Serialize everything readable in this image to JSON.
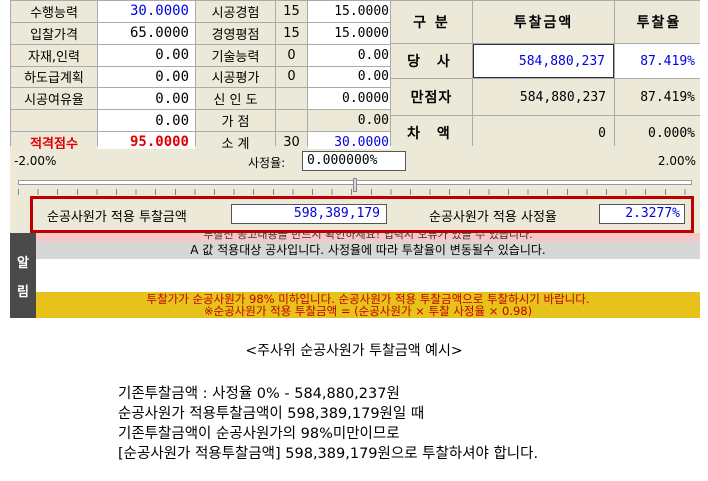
{
  "score": {
    "rows": [
      {
        "label": "수행능력",
        "value": "30.0000",
        "label2": "시공경험",
        "num": "15",
        "value2": "15.0000"
      },
      {
        "label": "입찰가격",
        "value": "65.0000",
        "label2": "경영평점",
        "num": "15",
        "value2": "15.0000"
      },
      {
        "label": "자재,인력",
        "value": "0.00",
        "label2": "기술능력",
        "num": "0",
        "value2": "0.00"
      },
      {
        "label": "하도급계획",
        "value": "0.00",
        "label2": "시공평가",
        "num": "0",
        "value2": "0.00"
      },
      {
        "label": "시공여유율",
        "value": "0.00",
        "label2": "신 인 도",
        "num": "",
        "value2": "0.0000"
      },
      {
        "label": "",
        "value": "0.00",
        "label2": "가 점",
        "num": "",
        "value2": "0.00"
      },
      {
        "label": "적격점수",
        "value": "95.0000",
        "label2": "소 계",
        "num": "30",
        "value2": "30.0000"
      }
    ]
  },
  "bid": {
    "headers": [
      "구 분",
      "투찰금액",
      "투찰율"
    ],
    "rows": [
      {
        "label": "당 사",
        "amount": "584,880,237",
        "rate": "87.419%"
      },
      {
        "label": "만점자",
        "amount": "584,880,237",
        "rate": "87.419%"
      },
      {
        "label": "차 액",
        "amount": "0",
        "rate": "0.000%"
      }
    ]
  },
  "rate": {
    "low": "-2.00%",
    "high": "2.00%",
    "label": "사정율:",
    "value": "0.000000%"
  },
  "slider": {
    "level_fraction": 0.5
  },
  "highlight": {
    "label1": "순공사원가 적용 투찰금액",
    "value1": "598,389,179",
    "label2": "순공사원가 적용 사정율",
    "value2": "2.3277%"
  },
  "alert": {
    "side": [
      "알",
      "림"
    ],
    "msg1": "투찰전 공고내용을 반드시 확인하세요! 입력시 오류가 있을 수 있습니다.",
    "msg2": "A 값 적용대상 공사입니다. 사정율에 따라 투찰율이 변동될수 있습니다.",
    "msg4a": "투찰가가 순공사원가 98% 미하입니다. 순공사원가 적용 투찰금액으로 투찰하시기 바랍니다.",
    "msg4b": "※순공사원가 적용 투찰금액 = (순공사원가 × 투찰 사정율 × 0.98)"
  },
  "caption": "<주사위 순공사원가 투찰금액 예시>",
  "body": [
    "기존투찰금액 : 사정율 0% - 584,880,237원",
    "순공사원가 적용투찰금액이 598,389,179원일 때",
    "기존투찰금액이 순공사원가의 98%미만이므로",
    "[순공사원가 적용투찰금액] 598,389,179원으로 투찰하셔야 합니다."
  ]
}
